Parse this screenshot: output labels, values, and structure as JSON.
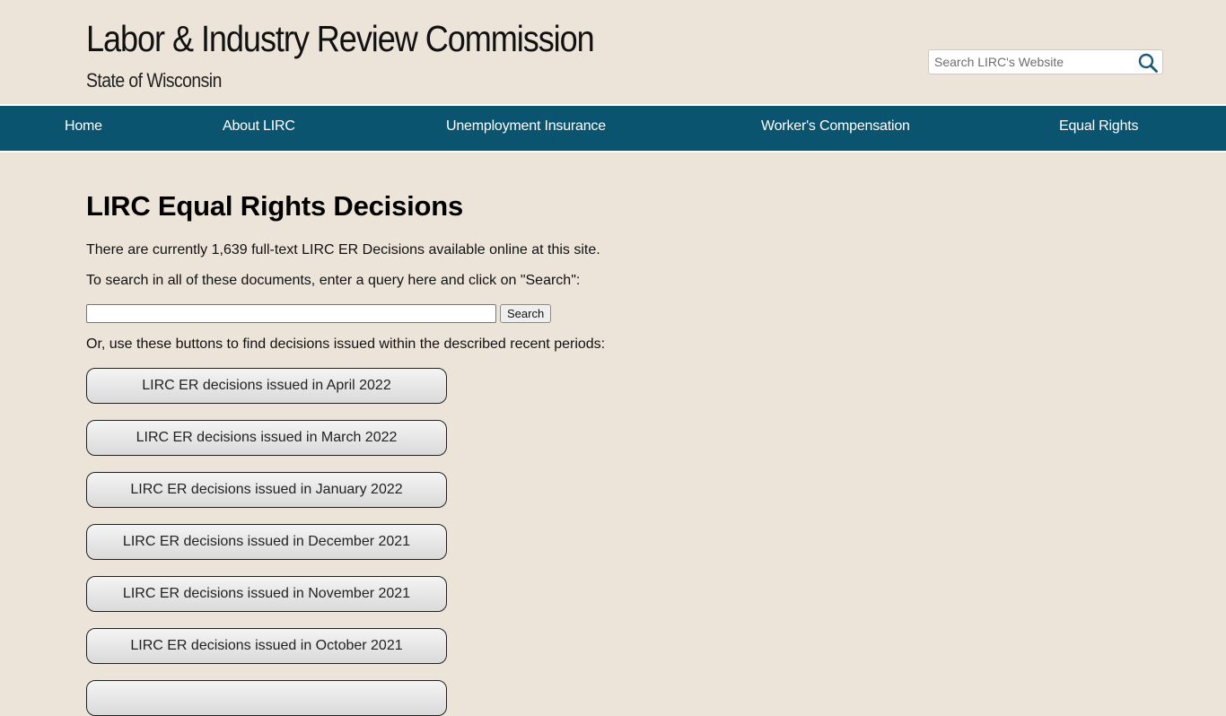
{
  "header": {
    "title": "Labor & Industry Review Commission",
    "subtitle": "State of Wisconsin",
    "search_placeholder": "Search LIRC's Website",
    "search_icon": "magnifier-icon"
  },
  "nav": {
    "items": [
      {
        "label": "Home"
      },
      {
        "label": "About LIRC"
      },
      {
        "label": "Unemployment Insurance"
      },
      {
        "label": "Worker's Compensation"
      },
      {
        "label": "Equal Rights"
      }
    ]
  },
  "main": {
    "title": "LIRC Equal Rights Decisions",
    "intro": "There are currently 1,639 full-text LIRC ER Decisions available online at this site.",
    "search_prompt": "To search in all of these documents, enter a query here and click on \"Search\":",
    "query_value": "",
    "search_button": "Search",
    "periods_prompt": "Or, use these buttons to find decisions issued within the described recent periods:",
    "period_buttons": [
      {
        "label": "LIRC ER decisions issued in April 2022"
      },
      {
        "label": "LIRC ER decisions issued in March 2022"
      },
      {
        "label": "LIRC ER decisions issued in January 2022"
      },
      {
        "label": "LIRC ER decisions issued in December 2021"
      },
      {
        "label": "LIRC ER decisions issued in November 2021"
      },
      {
        "label": "LIRC ER decisions issued in October 2021"
      },
      {
        "label": ""
      }
    ]
  },
  "colors": {
    "background": "#ece3d9",
    "nav": "#0b5470",
    "search_icon": "#1a5a78"
  }
}
